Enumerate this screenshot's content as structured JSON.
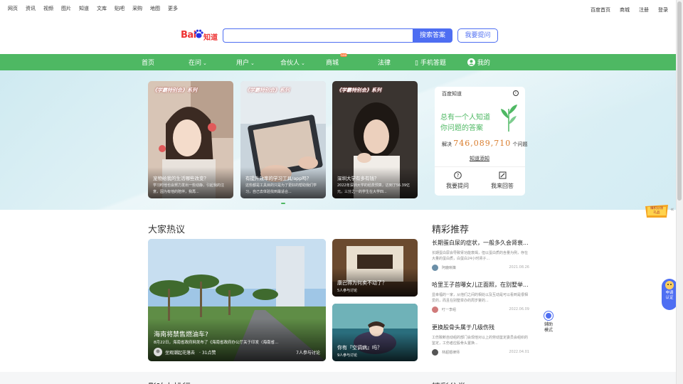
{
  "topnav": {
    "left": [
      "网页",
      "资讯",
      "视频",
      "图片",
      "知道",
      "文库",
      "贴吧",
      "采购",
      "地图",
      "更多"
    ],
    "right": [
      "百度首页",
      "商城",
      "注册",
      "登录"
    ]
  },
  "logo": {
    "bai": "Bai",
    "zhidao": "知道"
  },
  "search": {
    "placeholder": "",
    "button": "搜索答案",
    "ask": "我要提问"
  },
  "nav": {
    "items": [
      "首页",
      "在问",
      "用户",
      "合伙人",
      "商城",
      "法律",
      "手机答题",
      "我的"
    ],
    "new_badge": "new"
  },
  "hero_cards": [
    {
      "banner": "《学霸特别会》系列",
      "title": "宠物给我的生活哪些改变？",
      "desc": "学习时他也会努力发出一些动静，引起我的注意，因为有他的陪伴，我再..."
    },
    {
      "banner": "《学霸特别会》系列",
      "title": "有提升效率的学习工具/app吗？",
      "desc": "这些都是工具目的只是为了更好的帮助我们学习，自己去体验找到最适合..."
    },
    {
      "banner": "《学霸特别会》系列",
      "title": "深圳大学有多有钱？",
      "desc": "2022年深圳大学的经费预算，达到了56.39亿元，三分之一的学生在大学四..."
    }
  ],
  "zhidao_panel": {
    "header": "百度知道",
    "slogan1": "总有一个人知道",
    "slogan2": "你问题的答案",
    "solved_prefix": "解决",
    "solved_count": "746,089,710",
    "solved_suffix": "个问题",
    "link": "知道添知",
    "ask": "我要提问",
    "answer": "我来回答"
  },
  "hot": {
    "title": "大家热议",
    "big": {
      "title": "海南将禁售燃油车?",
      "desc": "8月22日，海南省政府网发布了《海南省政府办公厅关于印发〈海南省...",
      "author": "坐观潮起花落去",
      "likes": "· 31点赞",
      "discuss": "7人参与讨论"
    },
    "small": [
      {
        "title": "康巴得为何卖不动了？",
        "discuss": "5人参与讨论"
      },
      {
        "title": "你有『空调病』吗？",
        "discuss": "9人参与讨论"
      }
    ]
  },
  "recommend": {
    "title": "精彩推荐",
    "items": [
      {
        "title": "长期蛋白尿的症状，一般多久会肾衰...",
        "desc": "长期蛋白尿会导致肾功能衰竭，但以蛋白质的含量为例，存在大量的蛋白质，白蛋白24小时肾子...",
        "author": "阿鹿晰策",
        "date": "2021.08.26"
      },
      {
        "title": "哈里王子首曝女儿正面照，在别墅举...",
        "desc": "显幸福的一家，从他们之间的相处以及互动是可以看到是很相爱的，而且在别墅举办的周岁宴的...",
        "author": "叮一李组",
        "date": "2022.06.09"
      },
      {
        "title": "更换股骨头属于几级伤残",
        "desc": "工伤致断自动组的部门会现他对以上的劳动鉴定委员会组织的鉴定，工伤者应股骨头置换...",
        "author": "林超婚律师",
        "date": "2022.04.01"
      }
    ]
  },
  "bottom": {
    "left": "影响力排行",
    "right": "精彩分类"
  },
  "floats": {
    "gift": "赚积分领礼品",
    "cert": "申请认证",
    "assist": "辅助模式"
  }
}
